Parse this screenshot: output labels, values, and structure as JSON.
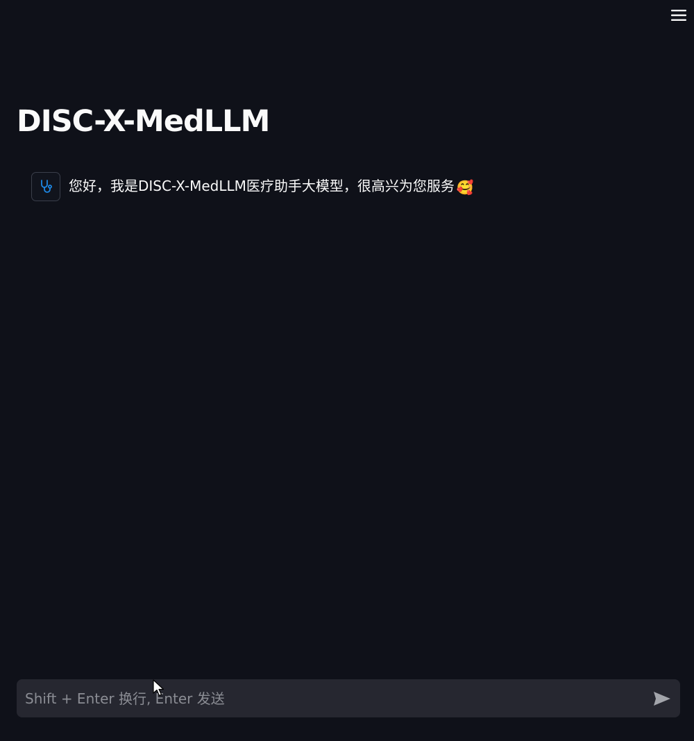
{
  "header": {
    "menu_icon": "hamburger-menu-icon"
  },
  "page": {
    "title": "DISC-X-MedLLM"
  },
  "chat": {
    "messages": [
      {
        "role": "assistant",
        "avatar_icon": "stethoscope-icon",
        "text": "您好，我是DISC-X-MedLLM医疗助手大模型，很高兴为您服务",
        "emoji": "🥰"
      }
    ]
  },
  "input": {
    "placeholder": "Shift + Enter 换行, Enter 发送",
    "value": "",
    "send_icon": "send-icon"
  },
  "colors": {
    "background": "#0f1119",
    "input_background": "#262730",
    "text": "#fafafa",
    "placeholder": "#8b8d94",
    "avatar_accent": "#1e88e5"
  }
}
